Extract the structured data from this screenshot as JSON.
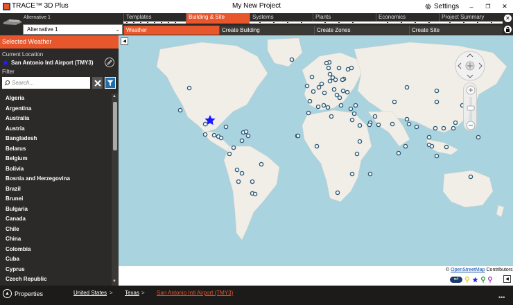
{
  "window": {
    "app_title": "TRACE™ 3D Plus",
    "project_title": "My New Project",
    "settings_label": "Settings",
    "minimize_glyph": "–",
    "maximize_glyph": "❐",
    "close_glyph": "✕"
  },
  "alternative": {
    "label": "Alternative 1",
    "selected": "Alternative 1"
  },
  "tabs": [
    {
      "label": "Templates",
      "active": false
    },
    {
      "label": "Building & Site",
      "active": true
    },
    {
      "label": "Systems",
      "active": false
    },
    {
      "label": "Plants",
      "active": false
    },
    {
      "label": "Economics",
      "active": false
    },
    {
      "label": "Project Summary",
      "active": false
    }
  ],
  "subtabs": [
    {
      "label": "Weather",
      "active": true
    },
    {
      "label": "Create Building",
      "active": false
    },
    {
      "label": "Create Zones",
      "active": false
    },
    {
      "label": "Create Site",
      "active": false
    }
  ],
  "left_panel": {
    "header": "Selected Weather",
    "current_location_label": "Current Location",
    "current_location": "San Antonio Intl Airport (TMY3)",
    "filter_label": "Filter",
    "search_placeholder": "Search...",
    "countries": [
      "Algeria",
      "Argentina",
      "Australia",
      "Austria",
      "Bangladesh",
      "Belarus",
      "Belgium",
      "Bolivia",
      "Bosnia and Herzegovina",
      "Brazil",
      "Brunei",
      "Bulgaria",
      "Canada",
      "Chile",
      "China",
      "Colombia",
      "Cuba",
      "Cyprus",
      "Czech Republic"
    ]
  },
  "map": {
    "attribution_prefix": "©",
    "attribution_link": "OpenStreetMap",
    "attribution_suffix": "Contributors",
    "legend_pill": "●#",
    "colors": {
      "water": "#a9d3df",
      "land": "#f1eee8",
      "station": "#2f5b76",
      "selected": "#1a1aff"
    }
  },
  "bottom": {
    "properties_label": "Properties",
    "breadcrumb": [
      "United States",
      "Texas",
      "San Antonio Intl Airport (TMY3)"
    ],
    "more_glyph": "•••"
  },
  "colors": {
    "accent": "#e8562c",
    "dark": "#2b2a28"
  }
}
